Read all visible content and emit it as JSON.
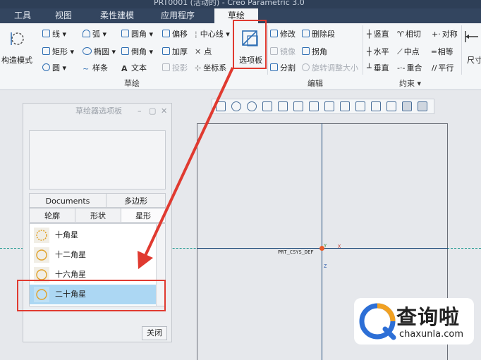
{
  "window": {
    "title": "PRT0001 (活动的) - Creo Parametric 3.0"
  },
  "tabs": [
    {
      "label": "工具"
    },
    {
      "label": "视图"
    },
    {
      "label": "柔性建模"
    },
    {
      "label": "应用程序"
    },
    {
      "label": "草绘"
    }
  ],
  "ribbon": {
    "construct_mode": "构造模式",
    "sketch_tools": {
      "line": "线",
      "arc": "弧",
      "fillet": "圆角",
      "offset": "偏移",
      "centerline": "中心线",
      "rectangle": "矩形",
      "ellipse": "椭圆",
      "chamfer": "倒角",
      "thicken": "加厚",
      "point": "点",
      "circle": "圆",
      "spline": "样条",
      "text": "文本",
      "project": "投影",
      "coordinate_system": "坐标系"
    },
    "palette_button": "选项板",
    "group_sketch": "草绘",
    "edit_tools": {
      "modify": "修改",
      "delete_segment": "删除段",
      "mirror": "镜像",
      "corner": "拐角",
      "divide": "分割",
      "rotate_resize": "旋转调整大小"
    },
    "group_edit": "编辑",
    "constraint_tools": {
      "vertical": "竖直",
      "tangent": "相切",
      "symmetric": "对称",
      "horizontal": "水平",
      "midpoint": "中点",
      "equal": "相等",
      "perpendicular": "垂直",
      "coincident": "重合",
      "parallel": "平行"
    },
    "group_constraint": "约束",
    "dimension": "尺寸"
  },
  "palette": {
    "title": "草绘器选项板",
    "tabs_row1": [
      "Documents",
      "多边形"
    ],
    "tabs_row2": [
      "轮廓",
      "形状",
      "星形"
    ],
    "active_tab": "星形",
    "items": [
      {
        "label": "十角星"
      },
      {
        "label": "十二角星"
      },
      {
        "label": "十六角星"
      },
      {
        "label": "二十角星",
        "selected": true
      }
    ],
    "close": "关闭"
  },
  "canvas": {
    "csys_label": "PRT_CSYS_DEF",
    "axis_x": "X",
    "axis_y": "Y",
    "axis_z": "Z"
  },
  "watermark": {
    "name": "查询啦",
    "url": "chaxunla.com"
  },
  "colors": {
    "highlight_red": "#e03a30",
    "selection_blue": "#acd7f3",
    "tab_bar": "#33455f"
  }
}
